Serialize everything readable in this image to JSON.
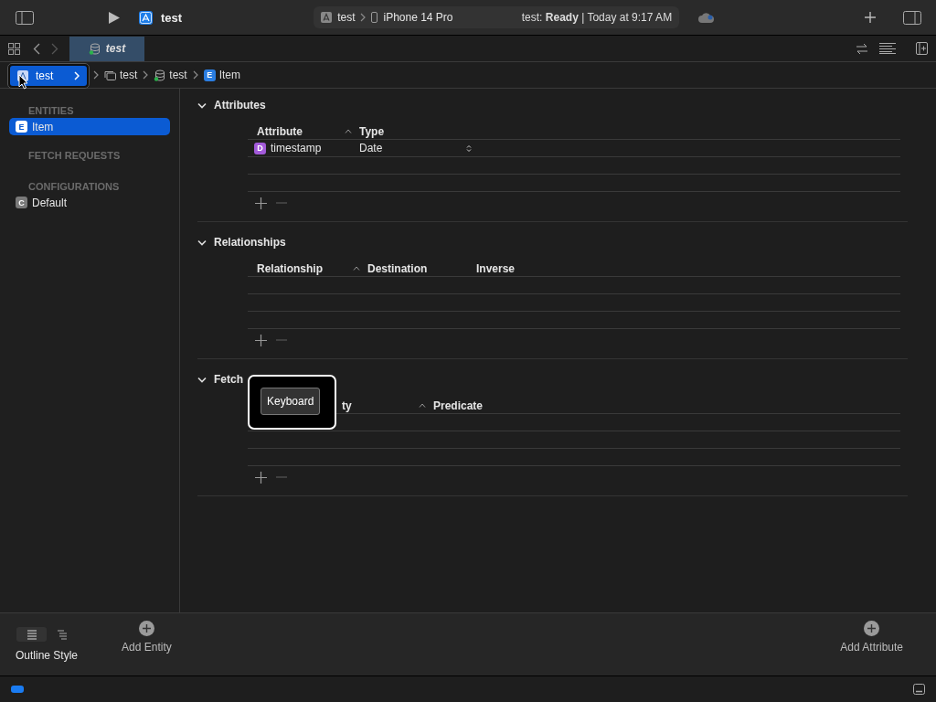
{
  "toolbar": {
    "project": "test",
    "scheme": "test",
    "device": "iPhone 14 Pro",
    "status": "test: **Ready** | Today at 9:17 AM"
  },
  "tabs": [
    {
      "label": "test",
      "selected": true
    }
  ],
  "breadcrumb": {
    "popup": "test",
    "items": [
      {
        "kind": "group",
        "label": "test"
      },
      {
        "kind": "model",
        "label": "test"
      },
      {
        "kind": "entity",
        "badge": "E",
        "label": "Item"
      }
    ]
  },
  "sidebar": {
    "sections": [
      {
        "title": "ENTITIES",
        "items": [
          {
            "badge": "E",
            "label": "Item",
            "selected": true
          }
        ]
      },
      {
        "title": "FETCH REQUESTS"
      },
      {
        "title": "CONFIGURATIONS",
        "items": [
          {
            "badge": "C",
            "label": "Default",
            "selected": false
          }
        ]
      }
    ]
  },
  "sections": [
    {
      "title": "Attributes",
      "expanded": true,
      "columns": [
        {
          "label": "Attribute",
          "sorted": true
        },
        {
          "label": "Type",
          "sorted": false
        }
      ],
      "rows": [
        {
          "badge": "D",
          "name": "timestamp",
          "type": "Date"
        }
      ]
    },
    {
      "title": "Relationships",
      "expanded": true,
      "columns": [
        {
          "label": "Relationship",
          "sorted": true
        },
        {
          "label": "Destination",
          "sorted": false
        },
        {
          "label": "Inverse",
          "sorted": false
        }
      ]
    },
    {
      "title": "Fetch",
      "expanded": true,
      "columns": [
        {
          "label": "ty",
          "sorted": true
        },
        {
          "label": "Predicate",
          "sorted": false
        }
      ]
    }
  ],
  "keyboard_overlay": {
    "label": "Keyboard"
  },
  "bottom_bar": {
    "outline_style": {
      "label": "Outline Style",
      "options": [
        {
          "kind": "flat",
          "selected": true
        },
        {
          "kind": "hierarchy",
          "selected": false
        }
      ]
    },
    "add_entity": "Add Entity",
    "add_attribute": "Add Attribute"
  }
}
